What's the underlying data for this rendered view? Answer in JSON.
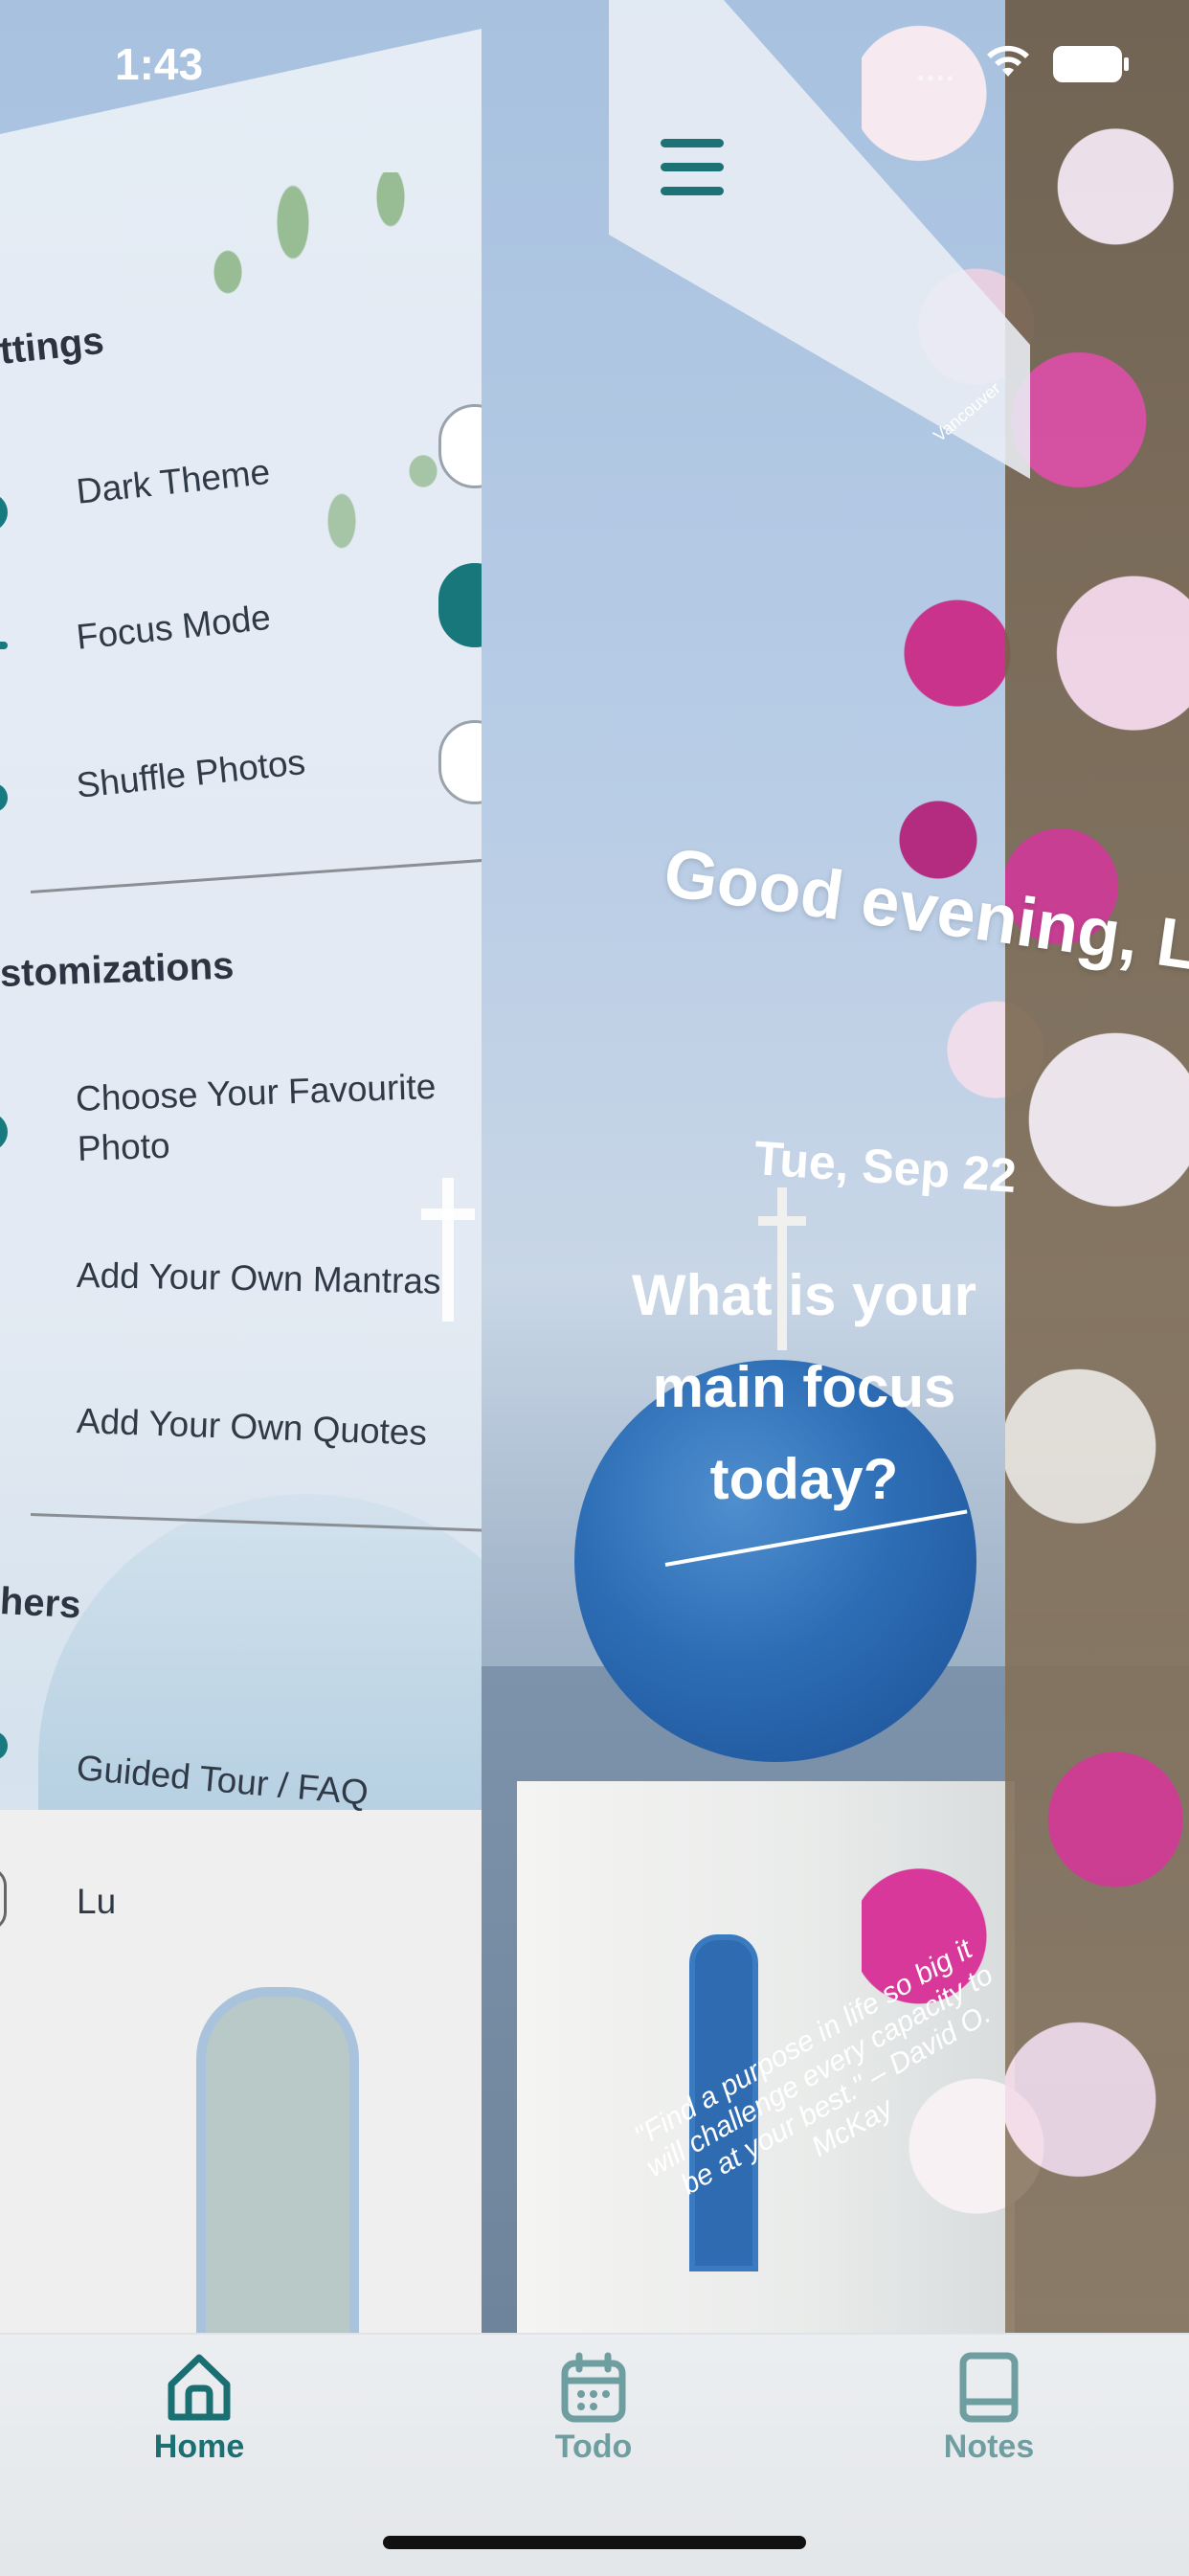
{
  "status_bar": {
    "time": "1:43"
  },
  "drawer": {
    "settings": {
      "title": "ttings",
      "items": [
        {
          "label": "Dark Theme",
          "toggle_on": false
        },
        {
          "label": "Focus Mode",
          "toggle_on": true
        },
        {
          "label": "Shuffle Photos",
          "toggle_on": false
        }
      ]
    },
    "customizations": {
      "title": "stomizations",
      "items": [
        {
          "label": "Choose Your Favourite Photo"
        },
        {
          "label": "Add Your Own Mantras"
        },
        {
          "label": "Add Your Own Quotes"
        }
      ]
    },
    "others": {
      "title": "hers",
      "items": [
        {
          "label": "Guided Tour / FAQ"
        },
        {
          "label": "Lu"
        }
      ]
    }
  },
  "home": {
    "greeting": "Good evening, Lu",
    "date": "Tue, Sep 22",
    "focus_question": "What is your main focus today?",
    "quote": "\"Find a purpose in life so big it will challenge every capacity to be at your best.\" – David O. McKay",
    "photo_credit": "Vancouver"
  },
  "tabbar": {
    "tabs": [
      {
        "label": "Home",
        "active": true
      },
      {
        "label": "Todo",
        "active": false
      },
      {
        "label": "Notes",
        "active": false
      }
    ],
    "active_color": "#1a6f73",
    "inactive_color": "#6f9ea1"
  },
  "colors": {
    "accent": "#17777b"
  }
}
